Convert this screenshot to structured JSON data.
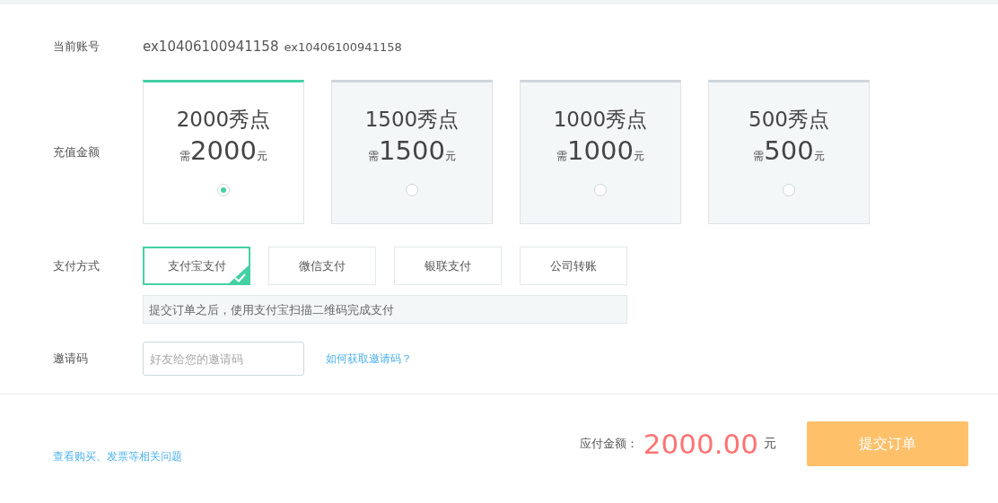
{
  "account": {
    "label": "当前账号",
    "name": "ex10406100941158",
    "id": "ex10406100941158"
  },
  "recharge": {
    "label": "充值金额",
    "packages": [
      {
        "points": "2000秀点",
        "prefix": "需",
        "amount": "2000",
        "unit": "元",
        "selected": true
      },
      {
        "points": "1500秀点",
        "prefix": "需",
        "amount": "1500",
        "unit": "元",
        "selected": false
      },
      {
        "points": "1000秀点",
        "prefix": "需",
        "amount": "1000",
        "unit": "元",
        "selected": false
      },
      {
        "points": "500秀点",
        "prefix": "需",
        "amount": "500",
        "unit": "元",
        "selected": false
      }
    ]
  },
  "payment": {
    "label": "支付方式",
    "methods": [
      {
        "label": "支付宝支付",
        "selected": true
      },
      {
        "label": "微信支付",
        "selected": false
      },
      {
        "label": "银联支付",
        "selected": false
      },
      {
        "label": "公司转账",
        "selected": false
      }
    ],
    "hint": "提交订单之后，使用支付宝扫描二维码完成支付"
  },
  "invite": {
    "label": "邀请码",
    "placeholder": "好友给您的邀请码",
    "help_link": "如何获取邀请码？"
  },
  "footer": {
    "help_link": "查看购买、发票等相关问题",
    "total_label": "应付金额：",
    "total": "2000.00",
    "unit": "元",
    "submit": "提交订单"
  }
}
